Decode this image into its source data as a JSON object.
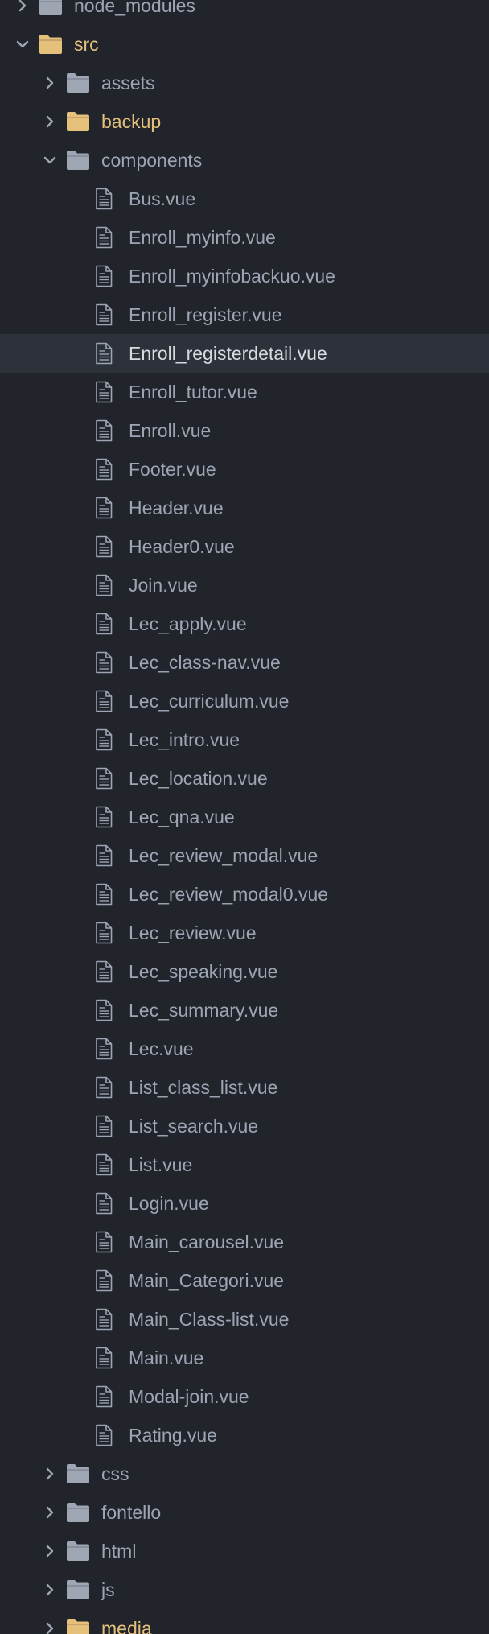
{
  "colors": {
    "text": "#9da5b4",
    "text_selected": "#d7dae0",
    "text_modified": "#e5c07b",
    "folder_gray": "#9ea5b3",
    "folder_yellow": "#e5c07b",
    "chevron": "#9da5b4",
    "file_icon": "#9da5b4",
    "background": "#21252b",
    "selected_row": "#2c313a"
  },
  "tree": [
    {
      "type": "folder",
      "label": "node_modules",
      "depth": 0,
      "expanded": false,
      "tone": "gray"
    },
    {
      "type": "folder",
      "label": "src",
      "depth": 0,
      "expanded": true,
      "tone": "yellow"
    },
    {
      "type": "folder",
      "label": "assets",
      "depth": 1,
      "expanded": false,
      "tone": "gray"
    },
    {
      "type": "folder",
      "label": "backup",
      "depth": 1,
      "expanded": false,
      "tone": "yellow"
    },
    {
      "type": "folder",
      "label": "components",
      "depth": 1,
      "expanded": true,
      "tone": "gray"
    },
    {
      "type": "file",
      "label": "Bus.vue",
      "depth": 2
    },
    {
      "type": "file",
      "label": "Enroll_myinfo.vue",
      "depth": 2
    },
    {
      "type": "file",
      "label": "Enroll_myinfobackuo.vue",
      "depth": 2
    },
    {
      "type": "file",
      "label": "Enroll_register.vue",
      "depth": 2
    },
    {
      "type": "file",
      "label": "Enroll_registerdetail.vue",
      "depth": 2,
      "selected": true
    },
    {
      "type": "file",
      "label": "Enroll_tutor.vue",
      "depth": 2
    },
    {
      "type": "file",
      "label": "Enroll.vue",
      "depth": 2
    },
    {
      "type": "file",
      "label": "Footer.vue",
      "depth": 2
    },
    {
      "type": "file",
      "label": "Header.vue",
      "depth": 2
    },
    {
      "type": "file",
      "label": "Header0.vue",
      "depth": 2
    },
    {
      "type": "file",
      "label": "Join.vue",
      "depth": 2
    },
    {
      "type": "file",
      "label": "Lec_apply.vue",
      "depth": 2
    },
    {
      "type": "file",
      "label": "Lec_class-nav.vue",
      "depth": 2
    },
    {
      "type": "file",
      "label": "Lec_curriculum.vue",
      "depth": 2
    },
    {
      "type": "file",
      "label": "Lec_intro.vue",
      "depth": 2
    },
    {
      "type": "file",
      "label": "Lec_location.vue",
      "depth": 2
    },
    {
      "type": "file",
      "label": "Lec_qna.vue",
      "depth": 2
    },
    {
      "type": "file",
      "label": "Lec_review_modal.vue",
      "depth": 2
    },
    {
      "type": "file",
      "label": "Lec_review_modal0.vue",
      "depth": 2
    },
    {
      "type": "file",
      "label": "Lec_review.vue",
      "depth": 2
    },
    {
      "type": "file",
      "label": "Lec_speaking.vue",
      "depth": 2
    },
    {
      "type": "file",
      "label": "Lec_summary.vue",
      "depth": 2
    },
    {
      "type": "file",
      "label": "Lec.vue",
      "depth": 2
    },
    {
      "type": "file",
      "label": "List_class_list.vue",
      "depth": 2
    },
    {
      "type": "file",
      "label": "List_search.vue",
      "depth": 2
    },
    {
      "type": "file",
      "label": "List.vue",
      "depth": 2
    },
    {
      "type": "file",
      "label": "Login.vue",
      "depth": 2
    },
    {
      "type": "file",
      "label": "Main_carousel.vue",
      "depth": 2
    },
    {
      "type": "file",
      "label": "Main_Categori.vue",
      "depth": 2
    },
    {
      "type": "file",
      "label": "Main_Class-list.vue",
      "depth": 2
    },
    {
      "type": "file",
      "label": "Main.vue",
      "depth": 2
    },
    {
      "type": "file",
      "label": "Modal-join.vue",
      "depth": 2
    },
    {
      "type": "file",
      "label": "Rating.vue",
      "depth": 2
    },
    {
      "type": "folder",
      "label": "css",
      "depth": 1,
      "expanded": false,
      "tone": "gray"
    },
    {
      "type": "folder",
      "label": "fontello",
      "depth": 1,
      "expanded": false,
      "tone": "gray"
    },
    {
      "type": "folder",
      "label": "html",
      "depth": 1,
      "expanded": false,
      "tone": "gray"
    },
    {
      "type": "folder",
      "label": "js",
      "depth": 1,
      "expanded": false,
      "tone": "gray"
    },
    {
      "type": "folder",
      "label": "media",
      "depth": 1,
      "expanded": false,
      "tone": "yellow"
    }
  ]
}
